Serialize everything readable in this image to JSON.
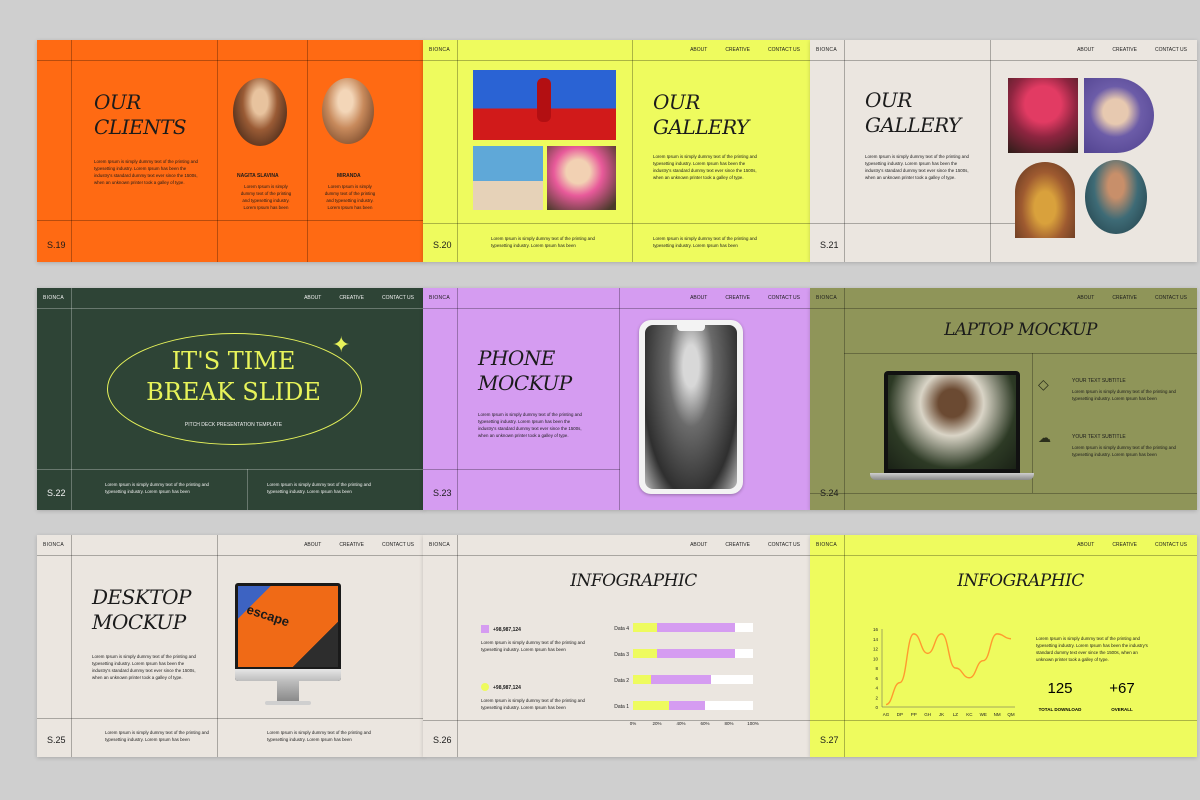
{
  "colors": {
    "background": "#cfcfcf",
    "orange": "#ff6a13",
    "lime": "#eefb5e",
    "cream": "#ebe6e0",
    "forest": "#2e4436",
    "lavender": "#d59cf1",
    "olive": "#8f9559"
  },
  "nav": {
    "about": "ABOUT",
    "creative": "CREATIVE",
    "contact": "CONTACT US"
  },
  "brand": "BIONCA",
  "lorem": "Lorem Ipsum is simply dummy text of the printing and typesetting industry. Lorem Ipsum has been the industry's standard dummy text ever since the 1500s, when an unknown printer took a galley of type.",
  "foot_text": "Lorem Ipsum is simply dummy text of the printing and typesetting industry. Lorem Ipsum has been",
  "slides": {
    "s19": {
      "number": "S.19",
      "title": "OUR\nCLIENTS",
      "name1": "NAGITA SLAVINA",
      "name2": "MIRANDA",
      "icon1": "client-portrait-photo",
      "icon2": "client-portrait-photo"
    },
    "s20": {
      "number": "S.20",
      "title": "OUR\nGALLERY"
    },
    "s21": {
      "number": "S.21",
      "title": "OUR\nGALLERY"
    },
    "s22": {
      "number": "S.22",
      "title": "IT'S TIME\nBREAK SLIDE",
      "subtitle": "PITCH DECK PRESENTATION TEMPLATE"
    },
    "s23": {
      "number": "S.23",
      "title": "PHONE\nMOCKUP"
    },
    "s24": {
      "number": "S.24",
      "title": "LAPTOP MOCKUP",
      "sub1": "YOUR TEXT SUBTITLE",
      "sub2": "YOUR TEXT SUBTITLE",
      "icon1": "diamond-icon",
      "icon2": "cloud-device-icon"
    },
    "s25": {
      "number": "S.25",
      "title": "DESKTOP\nMOCKUP",
      "screen_text": "escape"
    },
    "s26": {
      "number": "S.26",
      "title": "INFOGRAPHIC",
      "stat1": "+98,987,124",
      "stat2": "+98,987,124"
    },
    "s27": {
      "number": "S.27",
      "title": "INFOGRAPHIC",
      "kpi1_value": "125",
      "kpi1_label": "TOTAL DOWNLOAD",
      "kpi2_value": "+67",
      "kpi2_label": "OVERALL"
    }
  },
  "chart_data": [
    {
      "type": "bar",
      "stacked": true,
      "orientation": "horizontal",
      "categories": [
        "Data 4",
        "Data 3",
        "Data 2",
        "Data 1"
      ],
      "series": [
        {
          "color": "#eefb5e",
          "values": [
            20,
            20,
            15,
            30
          ]
        },
        {
          "color": "#d59cf1",
          "values": [
            65,
            65,
            50,
            30
          ]
        },
        {
          "color": "#ffffff",
          "values": [
            15,
            15,
            35,
            40
          ]
        }
      ],
      "x_ticks": [
        "0%",
        "20%",
        "40%",
        "60%",
        "80%",
        "100%"
      ],
      "xlim": [
        0,
        100
      ]
    },
    {
      "type": "line",
      "x": [
        "AG",
        "DP",
        "PP",
        "GH",
        "JK",
        "LZ",
        "KC",
        "WE",
        "NM",
        "QM"
      ],
      "values": [
        0.5,
        5,
        15,
        11,
        15,
        8,
        6,
        9.5,
        15,
        14
      ],
      "y_ticks": [
        "0",
        "2",
        "4",
        "6",
        "8",
        "10",
        "12",
        "14",
        "16"
      ],
      "ylim": [
        0,
        16
      ],
      "color": "#ff9a2e"
    }
  ]
}
